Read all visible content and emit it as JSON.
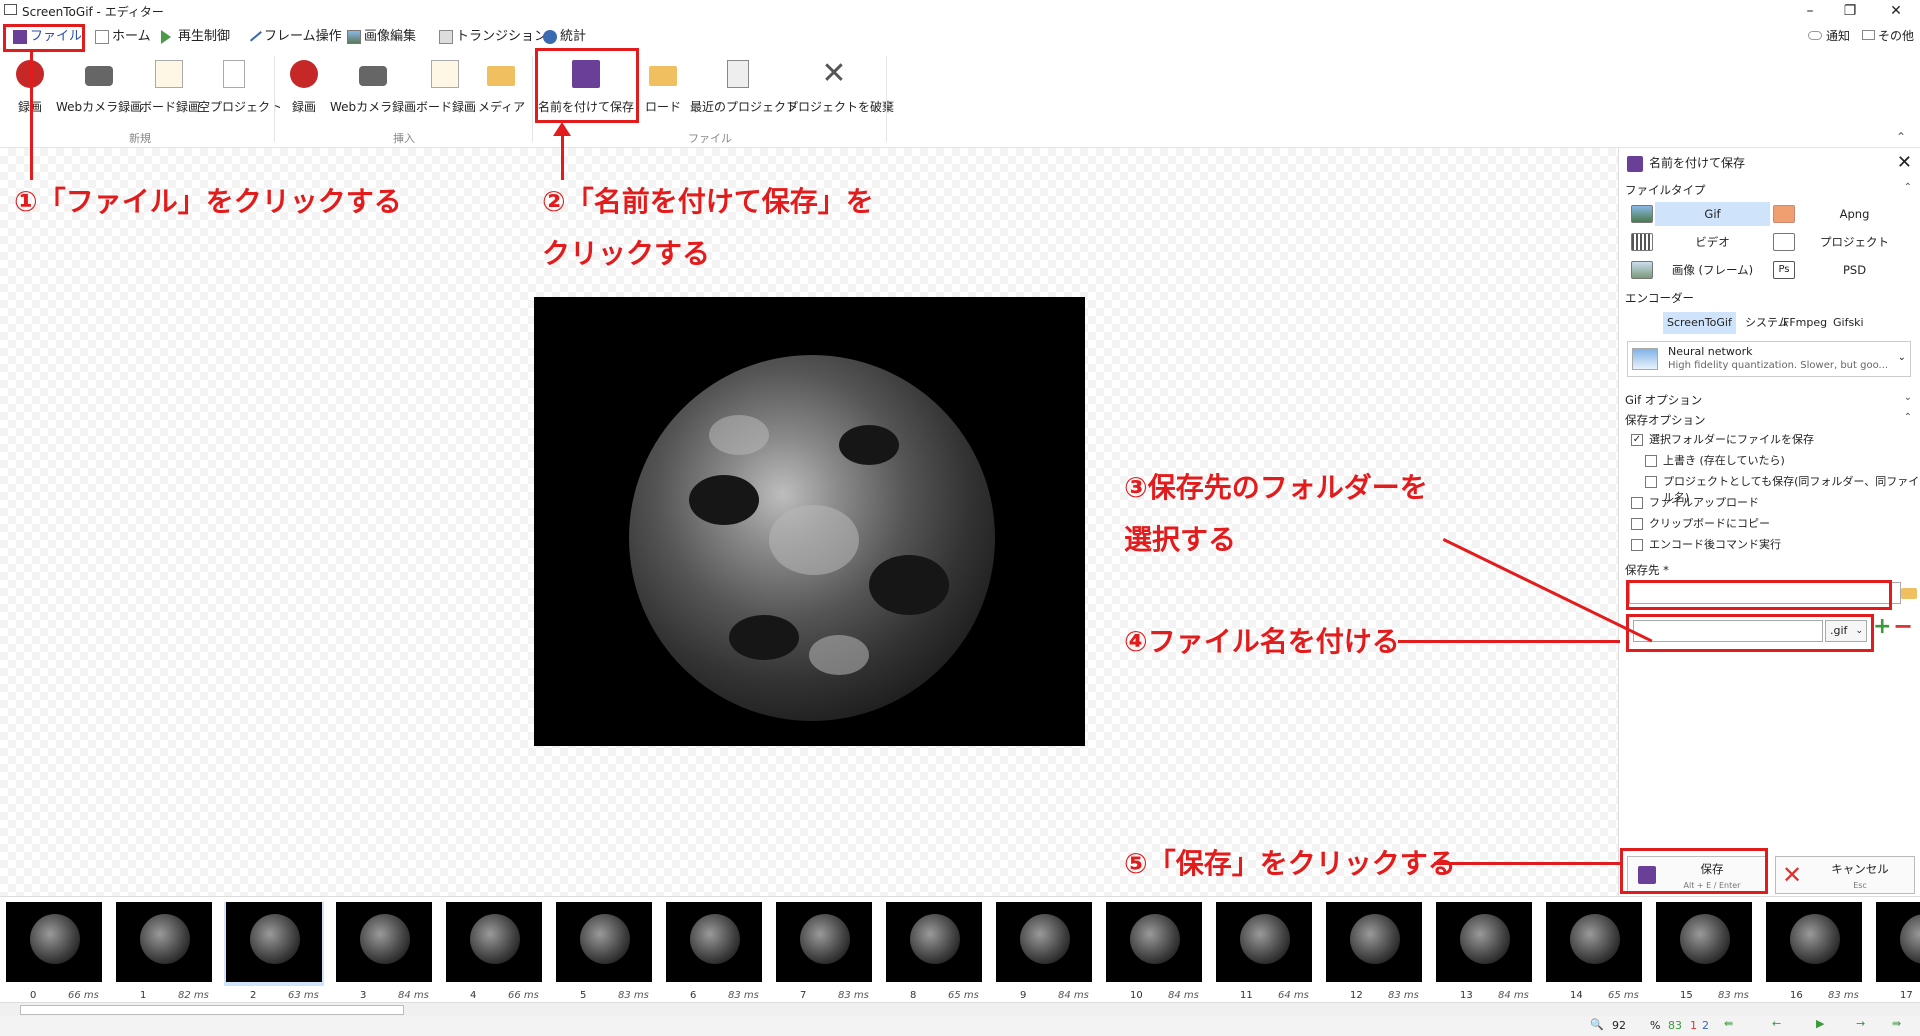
{
  "window": {
    "title": "ScreenToGif - エディター",
    "minimize": "–",
    "restore": "❐",
    "close": "✕"
  },
  "menu": {
    "tabs": [
      "ファイル",
      "ホーム",
      "再生制御",
      "フレーム操作",
      "画像編集",
      "トランジション",
      "統計"
    ],
    "notify": "通知",
    "other": "その他"
  },
  "ribbon": {
    "new": [
      "録画",
      "Webカメラ録画",
      "ボード録画",
      "空プロジェクト"
    ],
    "insert": [
      "録画",
      "Webカメラ録画",
      "ボード録画",
      "メディア"
    ],
    "file": [
      "名前を付けて保存",
      "ロード",
      "最近のプロジェクト",
      "プロジェクトを破棄"
    ],
    "groups": {
      "new": "新規",
      "insert": "挿入",
      "file": "ファイル"
    }
  },
  "panel": {
    "title": "名前を付けて保存",
    "filetype_label": "ファイルタイプ",
    "filetypes": [
      "Gif",
      "Apng",
      "ビデオ",
      "プロジェクト",
      "画像 (フレーム)",
      "PSD"
    ],
    "encoder_label": "エンコーダー",
    "encoders": [
      "ScreenToGif",
      "システム",
      "FFmpeg",
      "Gifski"
    ],
    "quant_title": "Neural network",
    "quant_desc": "High fidelity quantization. Slower, but goo...",
    "gif_options": "Gif オプション",
    "save_options": "保存オプション",
    "checks": [
      {
        "label": "選択フォルダーにファイルを保存",
        "checked": true
      },
      {
        "label": "上書き (存在していたら)",
        "checked": false
      },
      {
        "label": "プロジェクトとしても保存(同フォルダー、同ファイル名)",
        "checked": false
      },
      {
        "label": "ファイルアップロード",
        "checked": false
      },
      {
        "label": "クリップボードにコピー",
        "checked": false
      },
      {
        "label": "エンコード後コマンド実行",
        "checked": false
      }
    ],
    "save_to": "保存先 *",
    "ext": ".gif",
    "save_label": "保存",
    "save_shortcut": "Alt + E / Enter",
    "cancel_label": "キャンセル",
    "cancel_shortcut": "Esc"
  },
  "frames": [
    {
      "n": "0",
      "ms": "66 ms"
    },
    {
      "n": "1",
      "ms": "82 ms"
    },
    {
      "n": "2",
      "ms": "63 ms"
    },
    {
      "n": "3",
      "ms": "84 ms"
    },
    {
      "n": "4",
      "ms": "66 ms"
    },
    {
      "n": "5",
      "ms": "83 ms"
    },
    {
      "n": "6",
      "ms": "83 ms"
    },
    {
      "n": "7",
      "ms": "83 ms"
    },
    {
      "n": "8",
      "ms": "65 ms"
    },
    {
      "n": "9",
      "ms": "84 ms"
    },
    {
      "n": "10",
      "ms": "84 ms"
    },
    {
      "n": "11",
      "ms": "64 ms"
    },
    {
      "n": "12",
      "ms": "83 ms"
    },
    {
      "n": "13",
      "ms": "84 ms"
    },
    {
      "n": "14",
      "ms": "65 ms"
    },
    {
      "n": "15",
      "ms": "83 ms"
    },
    {
      "n": "16",
      "ms": "83 ms"
    },
    {
      "n": "17",
      "ms": ""
    }
  ],
  "status": {
    "zoom": "92",
    "pct": "%",
    "count": "83",
    "sel": "1",
    "cur": "2"
  },
  "annotations": {
    "a1": "①「ファイル」をクリックする",
    "a2a": "②「名前を付けて保存」を",
    "a2b": "クリックする",
    "a3a": "③保存先のフォルダーを",
    "a3b": "選択する",
    "a4": "④ファイル名を付ける",
    "a5": "⑤「保存」をクリックする"
  },
  "colors": {
    "accent": "#e21c1c",
    "selection": "#cfe3fa",
    "save_icon": "#6a3f98"
  }
}
